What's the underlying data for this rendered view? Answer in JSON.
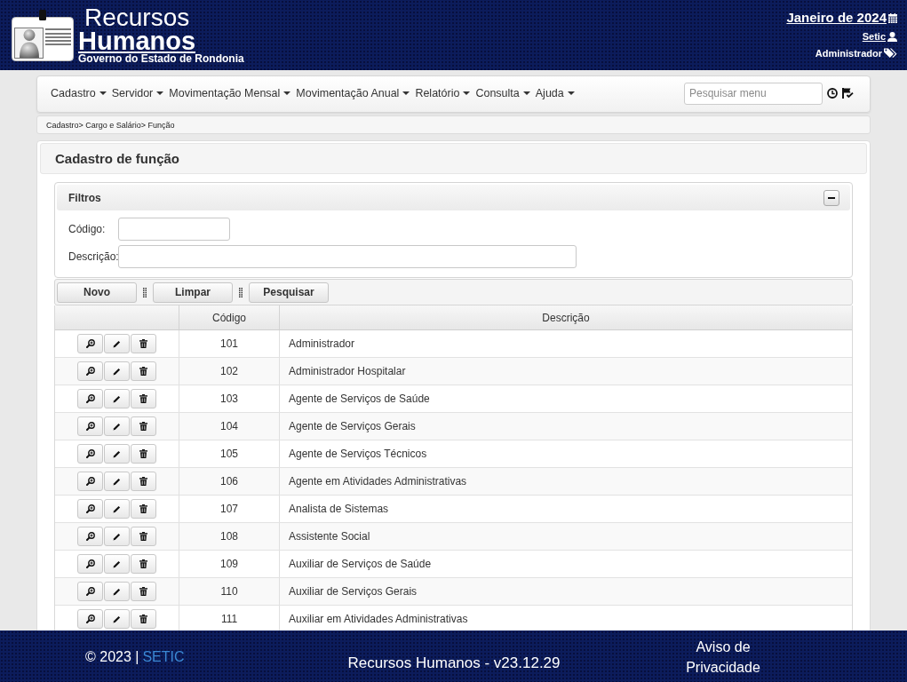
{
  "header": {
    "title_top": "Recursos",
    "title_bottom": "Humanos",
    "subtitle": "Governo do Estado de Rondonia",
    "period": "Janeiro de 2024",
    "user": "Setic",
    "role": "Administrador"
  },
  "menu": {
    "items": [
      "Cadastro",
      "Servidor",
      "Movimentação Mensal",
      "Movimentação Anual",
      "Relatório",
      "Consulta",
      "Ajuda"
    ],
    "search": {
      "placeholder": "Pesquisar menu"
    }
  },
  "breadcrumb": "Cadastro> Cargo e Salário> Função",
  "page_title": "Cadastro de função",
  "filters": {
    "title": "Filtros",
    "expanded": true,
    "fields": [
      {
        "label": "Código:",
        "kind": "short"
      },
      {
        "label": "Descrição:",
        "kind": "wide"
      }
    ]
  },
  "toolbar": {
    "buttons": [
      "Novo",
      "Limpar",
      "Pesquisar"
    ]
  },
  "table": {
    "columns": [
      "Código",
      "Descrição"
    ],
    "rows": [
      {
        "code": "101",
        "description": "Administrador"
      },
      {
        "code": "102",
        "description": "Administrador Hospitalar"
      },
      {
        "code": "103",
        "description": "Agente de Serviços de Saúde"
      },
      {
        "code": "104",
        "description": "Agente de Serviços Gerais"
      },
      {
        "code": "105",
        "description": "Agente de Serviços Técnicos"
      },
      {
        "code": "106",
        "description": "Agente em Atividades Administrativas"
      },
      {
        "code": "107",
        "description": "Analista de Sistemas"
      },
      {
        "code": "108",
        "description": "Assistente Social"
      },
      {
        "code": "109",
        "description": "Auxiliar de Serviços de Saúde"
      },
      {
        "code": "110",
        "description": "Auxiliar de Serviços Gerais"
      },
      {
        "code": "111",
        "description": "Auxiliar em Atividades Administrativas"
      }
    ]
  },
  "footer": {
    "copyright": "© 2023 |",
    "link": "SETIC",
    "version": "Recursos Humanos - v23.12.29",
    "privacy": "Aviso de Privacidade"
  }
}
